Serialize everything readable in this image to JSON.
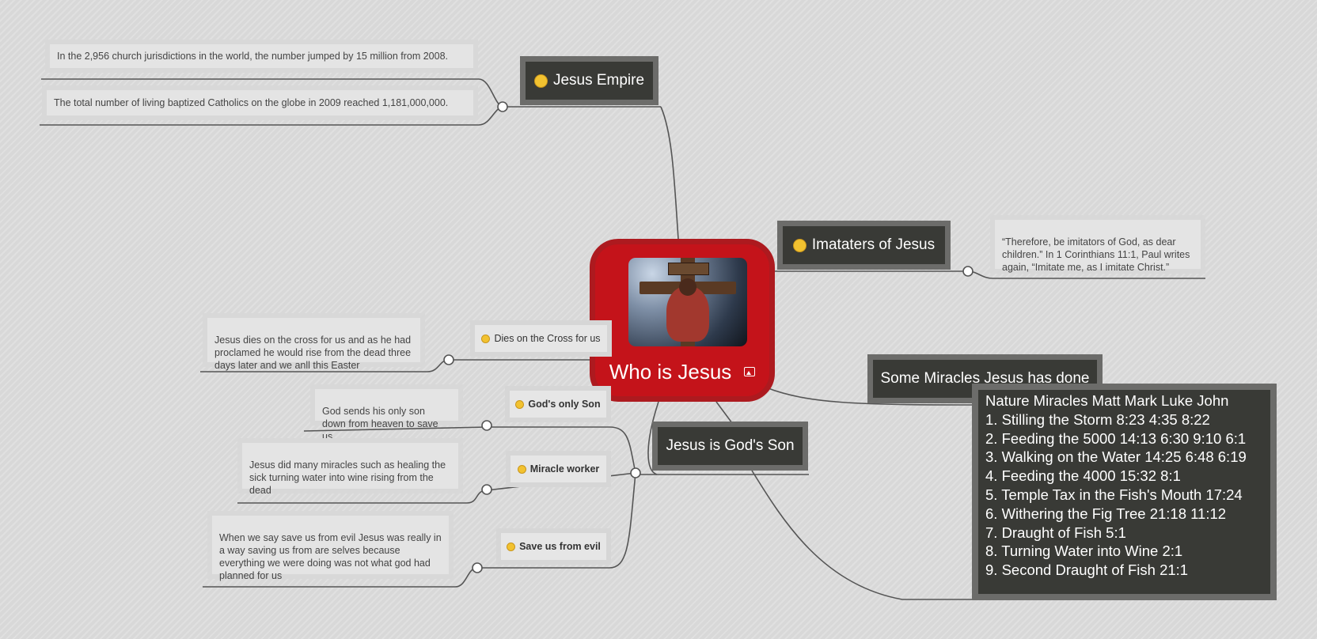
{
  "center": {
    "title": "Who is Jesus",
    "image_icon": "crucifix-image",
    "color": "#c4131a"
  },
  "topics": {
    "jesus_empire": {
      "label": "Jesus Empire",
      "icon": "smiley-icon",
      "notes": [
        "In the 2,956 church jurisdictions in the world, the number jumped by 15 million from 2008.",
        "The total number of living baptized Catholics on the globe in 2009 reached 1,181,000,000."
      ]
    },
    "imitators": {
      "label": "Imataters of Jesus",
      "icon": "worried-face-icon",
      "note": "“Therefore, be imitators of God, as dear children.”  In 1 Corinthians 11:1, Paul writes again, “Imitate me, as I imitate Christ.”"
    },
    "miracles": {
      "label": "Some Miracles Jesus has done",
      "lines": [
        "Nature Miracles Matt Mark Luke John",
        "1. Stilling the Storm 8:23 4:35 8:22",
        "2. Feeding the 5000 14:13 6:30 9:10 6:1",
        "3. Walking on the Water 14:25 6:48  6:19",
        "4. Feeding the 4000 15:32 8:1",
        "5. Temple Tax in the Fish's Mouth 17:24",
        "6. Withering the Fig Tree 21:18 11:12",
        "7. Draught of Fish   5:1",
        "8. Turning Water into Wine    2:1",
        "9. Second Draught of Fish    21:1"
      ]
    },
    "gods_son": {
      "label": "Jesus is God's Son",
      "children": [
        {
          "label": "God's only Son",
          "icon": "neutral-face-icon",
          "note": "God sends his only son down from heaven to save us"
        },
        {
          "label": "Miracle worker",
          "icon": "sad-face-icon",
          "note": "Jesus did many miracles such as healing the sick turning water into wine rising from the dead"
        },
        {
          "label": "Save us from evil",
          "icon": "sad-face-icon",
          "note": "When we say save us from evil Jesus was really in a way saving us from are selves because everything we were doing was not what god had planned for us"
        }
      ]
    },
    "cross": {
      "label": "Dies on the Cross for us",
      "icon": "neutral-face-icon",
      "note": "Jesus dies on the cross for us and as he had proclamed he would rise from the dead three days later and we anll this Easter"
    }
  },
  "colors": {
    "background": "#dcdcdc",
    "dark_node": "#393a36",
    "dark_border": "#6c6c6a",
    "connector": "#555555"
  }
}
